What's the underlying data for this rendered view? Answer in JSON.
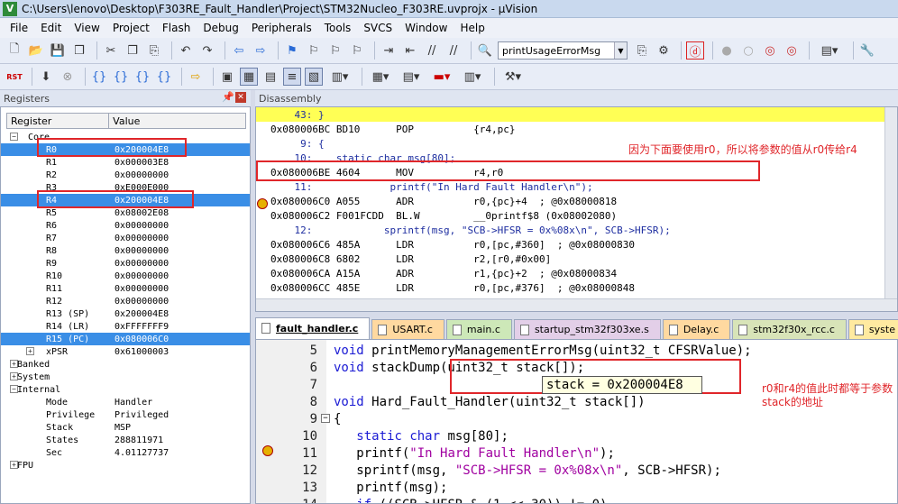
{
  "window": {
    "title": "C:\\Users\\lenovo\\Desktop\\F303RE_Fault_Handler\\Project\\STM32Nucleo_F303RE.uvprojx - µVision"
  },
  "menu": [
    "File",
    "Edit",
    "View",
    "Project",
    "Flash",
    "Debug",
    "Peripherals",
    "Tools",
    "SVCS",
    "Window",
    "Help"
  ],
  "toolbar": {
    "function_combo": "printUsageErrorMsg",
    "rst_label": "RST"
  },
  "registers_panel": {
    "title": "Registers",
    "col_register": "Register",
    "col_value": "Value",
    "rows": [
      {
        "name": "Core",
        "value": ""
      },
      {
        "name": "R0",
        "value": "0x200004E8"
      },
      {
        "name": "R1",
        "value": "0x000003E8"
      },
      {
        "name": "R2",
        "value": "0x00000000"
      },
      {
        "name": "R3",
        "value": "0xE000E000"
      },
      {
        "name": "R4",
        "value": "0x200004E8"
      },
      {
        "name": "R5",
        "value": "0x08002E08"
      },
      {
        "name": "R6",
        "value": "0x00000000"
      },
      {
        "name": "R7",
        "value": "0x00000000"
      },
      {
        "name": "R8",
        "value": "0x00000000"
      },
      {
        "name": "R9",
        "value": "0x00000000"
      },
      {
        "name": "R10",
        "value": "0x00000000"
      },
      {
        "name": "R11",
        "value": "0x00000000"
      },
      {
        "name": "R12",
        "value": "0x00000000"
      },
      {
        "name": "R13 (SP)",
        "value": "0x200004E8"
      },
      {
        "name": "R14 (LR)",
        "value": "0xFFFFFFF9"
      },
      {
        "name": "R15 (PC)",
        "value": "0x080006C0"
      },
      {
        "name": "xPSR",
        "value": "0x61000003"
      },
      {
        "name": "Banked",
        "value": ""
      },
      {
        "name": "System",
        "value": ""
      },
      {
        "name": "Internal",
        "value": ""
      },
      {
        "name": "Mode",
        "value": "Handler"
      },
      {
        "name": "Privilege",
        "value": "Privileged"
      },
      {
        "name": "Stack",
        "value": "MSP"
      },
      {
        "name": "States",
        "value": "288811971"
      },
      {
        "name": "Sec",
        "value": "4.01127737"
      },
      {
        "name": "FPU",
        "value": ""
      }
    ]
  },
  "disassembly": {
    "title": "Disassembly",
    "lines": [
      "    43: }",
      "0x080006BC BD10      POP          {r4,pc}",
      "     9: {",
      "    10:    static char msg[80];",
      "0x080006BE 4604      MOV          r4,r0",
      "    11:             printf(\"In Hard Fault Handler\\n\");",
      "0x080006C0 A055      ADR          r0,{pc}+4  ; @0x08000818",
      "0x080006C2 F001FCDD  BL.W         __0printf$8 (0x08002080)",
      "    12:            sprintf(msg, \"SCB->HFSR = 0x%08x\\n\", SCB->HFSR);",
      "0x080006C6 485A      LDR          r0,[pc,#360]  ; @0x08000830",
      "0x080006C8 6802      LDR          r2,[r0,#0x00]",
      "0x080006CA A15A      ADR          r1,{pc}+2  ; @0x08000834",
      "0x080006CC 485E      LDR          r0,[pc,#376]  ; @0x08000848"
    ],
    "annotation": "因为下面要使用r0，所以将参数的值从r0传给r4"
  },
  "tabs": [
    "fault_handler.c",
    "USART.c",
    "main.c",
    "startup_stm32f303xe.s",
    "Delay.c",
    "stm32f30x_rcc.c",
    "syste"
  ],
  "editor": {
    "lines": [
      {
        "n": "5",
        "code": "void printMemoryManagementErrorMsg(uint32_t CFSRValue);"
      },
      {
        "n": "6",
        "code": "void stackDump(uint32_t stack[]);"
      },
      {
        "n": "7",
        "code": ""
      },
      {
        "n": "8",
        "code": "void Hard_Fault_Handler(uint32_t stack[])"
      },
      {
        "n": "9",
        "code": "{"
      },
      {
        "n": "10",
        "code": "   static char msg[80];"
      },
      {
        "n": "11",
        "code": "   printf(\"In Hard Fault Handler\\n\");"
      },
      {
        "n": "12",
        "code": "   sprintf(msg, \"SCB->HFSR = 0x%08x\\n\", SCB->HFSR);"
      },
      {
        "n": "13",
        "code": "   printf(msg);"
      },
      {
        "n": "14",
        "code": "   if ((SCB->HFSR & (1 << 30)) != 0)"
      }
    ],
    "tooltip": "stack =  0x200004E8",
    "annotation_line1": "r0和r4的值此时都等于参数",
    "annotation_line2": "stack的地址"
  }
}
